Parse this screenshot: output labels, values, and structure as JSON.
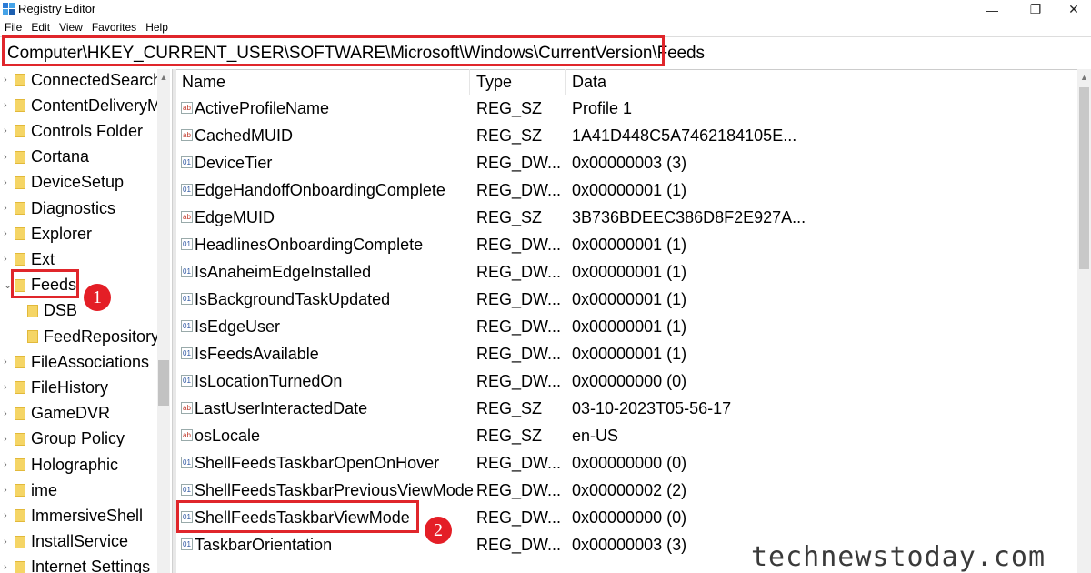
{
  "window": {
    "title": "Registry Editor",
    "min_glyph": "—",
    "max_glyph": "❐",
    "close_glyph": "✕"
  },
  "menu": [
    "File",
    "Edit",
    "View",
    "Favorites",
    "Help"
  ],
  "address": "Computer\\HKEY_CURRENT_USER\\SOFTWARE\\Microsoft\\Windows\\CurrentVersion\\Feeds",
  "tree": [
    {
      "label": "ConnectedSearch",
      "expanded": false
    },
    {
      "label": "ContentDeliveryM",
      "expanded": false
    },
    {
      "label": "Controls Folder",
      "expanded": false
    },
    {
      "label": "Cortana",
      "expanded": false
    },
    {
      "label": "DeviceSetup",
      "expanded": false
    },
    {
      "label": "Diagnostics",
      "expanded": false
    },
    {
      "label": "Explorer",
      "expanded": false
    },
    {
      "label": "Ext",
      "expanded": false
    },
    {
      "label": "Feeds",
      "expanded": true
    },
    {
      "label": "DSB",
      "child": true
    },
    {
      "label": "FeedRepository",
      "child": true
    },
    {
      "label": "FileAssociations",
      "expanded": false
    },
    {
      "label": "FileHistory",
      "expanded": false
    },
    {
      "label": "GameDVR",
      "expanded": false
    },
    {
      "label": "Group Policy",
      "expanded": false
    },
    {
      "label": "Holographic",
      "expanded": false
    },
    {
      "label": "ime",
      "expanded": false
    },
    {
      "label": "ImmersiveShell",
      "expanded": false
    },
    {
      "label": "InstallService",
      "expanded": false
    },
    {
      "label": "Internet Settings",
      "expanded": false
    }
  ],
  "columns": {
    "name": "Name",
    "type": "Type",
    "data": "Data"
  },
  "values": [
    {
      "name": "ActiveProfileName",
      "type": "REG_SZ",
      "data": "Profile 1",
      "icon": "string-value-icon"
    },
    {
      "name": "CachedMUID",
      "type": "REG_SZ",
      "data": "1A41D448C5A7462184105E...",
      "icon": "string-value-icon"
    },
    {
      "name": "DeviceTier",
      "type": "REG_DW...",
      "data": "0x00000003 (3)",
      "icon": "dword-value-icon"
    },
    {
      "name": "EdgeHandoffOnboardingComplete",
      "type": "REG_DW...",
      "data": "0x00000001 (1)",
      "icon": "dword-value-icon"
    },
    {
      "name": "EdgeMUID",
      "type": "REG_SZ",
      "data": "3B736BDEEC386D8F2E927A...",
      "icon": "string-value-icon"
    },
    {
      "name": "HeadlinesOnboardingComplete",
      "type": "REG_DW...",
      "data": "0x00000001 (1)",
      "icon": "dword-value-icon"
    },
    {
      "name": "IsAnaheimEdgeInstalled",
      "type": "REG_DW...",
      "data": "0x00000001 (1)",
      "icon": "dword-value-icon"
    },
    {
      "name": "IsBackgroundTaskUpdated",
      "type": "REG_DW...",
      "data": "0x00000001 (1)",
      "icon": "dword-value-icon"
    },
    {
      "name": "IsEdgeUser",
      "type": "REG_DW...",
      "data": "0x00000001 (1)",
      "icon": "dword-value-icon"
    },
    {
      "name": "IsFeedsAvailable",
      "type": "REG_DW...",
      "data": "0x00000001 (1)",
      "icon": "dword-value-icon"
    },
    {
      "name": "IsLocationTurnedOn",
      "type": "REG_DW...",
      "data": "0x00000000 (0)",
      "icon": "dword-value-icon"
    },
    {
      "name": "LastUserInteractedDate",
      "type": "REG_SZ",
      "data": "03-10-2023T05-56-17",
      "icon": "string-value-icon"
    },
    {
      "name": "osLocale",
      "type": "REG_SZ",
      "data": "en-US",
      "icon": "string-value-icon"
    },
    {
      "name": "ShellFeedsTaskbarOpenOnHover",
      "type": "REG_DW...",
      "data": "0x00000000 (0)",
      "icon": "dword-value-icon"
    },
    {
      "name": "ShellFeedsTaskbarPreviousViewMode",
      "type": "REG_DW...",
      "data": "0x00000002 (2)",
      "icon": "dword-value-icon"
    },
    {
      "name": "ShellFeedsTaskbarViewMode",
      "type": "REG_DW...",
      "data": "0x00000000 (0)",
      "icon": "dword-value-icon"
    },
    {
      "name": "TaskbarOrientation",
      "type": "REG_DW...",
      "data": "0x00000003 (3)",
      "icon": "dword-value-icon"
    }
  ],
  "annotations": {
    "badge1": "1",
    "badge2": "2",
    "highlight_color": "#e0262b"
  },
  "watermark": "technewstoday.com"
}
